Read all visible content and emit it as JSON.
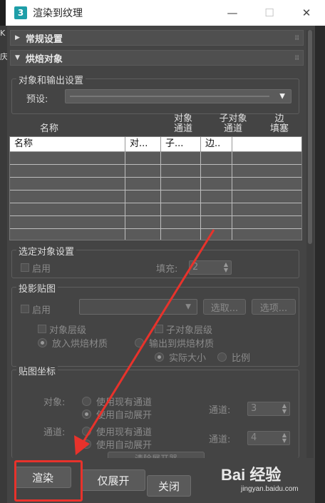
{
  "window": {
    "app_icon": "3",
    "title": "渲染到纹理",
    "minimize": "—",
    "maximize": "☐",
    "close": "✕"
  },
  "left_strip": [
    "K",
    "庆"
  ],
  "rollouts": {
    "general": "常规设置",
    "bake_objects": "烘焙对象"
  },
  "object_output": {
    "group_label": "对象和输出设置",
    "preset_label": "预设:",
    "preset_value": ""
  },
  "table": {
    "col_headers_top": [
      "名称",
      "对象\n通道",
      "子对象\n通道",
      "边\n填塞"
    ],
    "header_cells": [
      "名称",
      "对...",
      "子...",
      "边.."
    ],
    "empty_rows": 7
  },
  "selected_settings": {
    "group_label": "选定对象设置",
    "enable": "启用",
    "padding_label": "填充:",
    "padding_value": "2"
  },
  "projection": {
    "group_label": "投影贴图",
    "enable": "启用",
    "pick_button": "选取...",
    "options_button": "选项...",
    "object_level": "对象层级",
    "subobject_level": "子对象层级",
    "put_to_baked": "放入烘焙材质",
    "output_to_baked": "输出到烘焙材质",
    "actual_size": "实际大小",
    "proportion": "比例"
  },
  "map_coords": {
    "group_label": "贴图坐标",
    "object_label": "对象:",
    "channel_label": "通道:",
    "use_existing": "使用现有通道",
    "use_auto_unwrap": "使用自动展开",
    "channel_field_label": "通道:",
    "channel_value_1": "3",
    "channel_value_2": "4",
    "clear_unwrapper": "清除展开器"
  },
  "footer": {
    "render": "渲染",
    "unwrap_only": "仅展开",
    "close": "关闭"
  },
  "watermark": {
    "logo": "Bai 经验",
    "url": "jingyan.baidu.com"
  },
  "colors": {
    "annotation_red": "#e8322b"
  }
}
